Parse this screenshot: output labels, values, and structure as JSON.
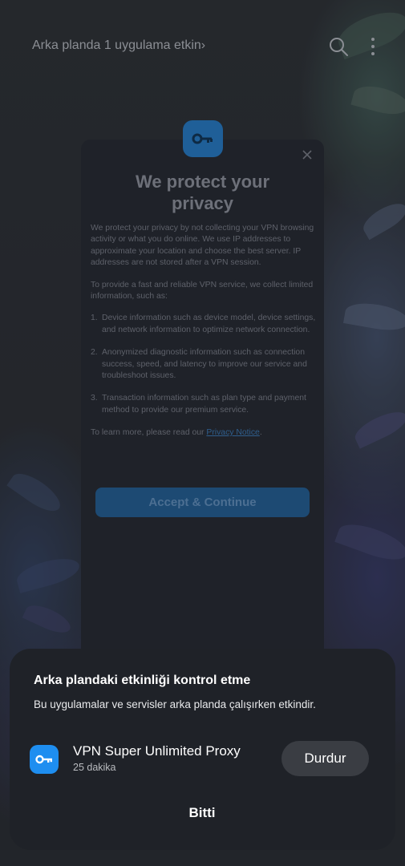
{
  "top_bar": {
    "background_apps_link": "Arka planda 1 uygulama etkin",
    "chevron": "›",
    "search_icon": "search-icon",
    "more_icon": "more-vertical-icon"
  },
  "vpn_dialog": {
    "title_line1": "We protect your",
    "title_line2": "privacy",
    "intro": "We protect your privacy by not collecting your VPN browsing activity or what you do online. We use IP addresses to approximate your location and choose the best server. IP addresses are not stored after a VPN session.",
    "collect_intro": "To provide a fast and reliable VPN service, we collect limited information, such as:",
    "items": [
      {
        "num": "1.",
        "text": "Device information such as device model, device settings, and network information to optimize network connection."
      },
      {
        "num": "2.",
        "text": "Anonymized diagnostic information such as connection success, speed, and latency to improve our service and troubleshoot issues."
      },
      {
        "num": "3.",
        "text": "Transaction information such as plan type and payment method to provide our premium service."
      }
    ],
    "learn_more_prefix": "To learn more, please read our ",
    "privacy_link": "Privacy Notice",
    "learn_more_suffix": ".",
    "accept_button": "Accept & Continue"
  },
  "sheet": {
    "title": "Arka plandaki etkinliği kontrol etme",
    "description": "Bu uygulamalar ve servisler arka planda çalışırken etkindir.",
    "app": {
      "name": "VPN Super Unlimited Proxy",
      "duration": "25 dakika",
      "stop_button": "Durdur"
    },
    "done_button": "Bitti"
  }
}
